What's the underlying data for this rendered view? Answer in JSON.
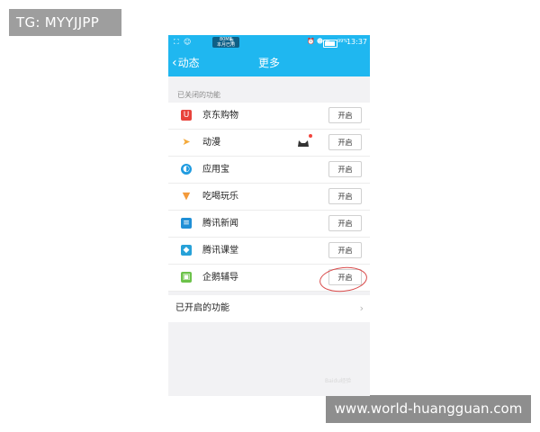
{
  "overlay": {
    "tg_tag": "TG: MYYJJPP",
    "url_tag": "www.world-huangguan.com"
  },
  "status_bar": {
    "net_speed": "80MB",
    "net_sub": "本月已用",
    "battery_pct": "99%",
    "time": "13:37"
  },
  "nav": {
    "back_label": "动态",
    "title": "更多"
  },
  "closed_section": {
    "label": "已关闭的功能",
    "items": [
      {
        "label": "京东购物",
        "button": "开启",
        "icon": "jd-shopping-icon",
        "color": "#e8433b"
      },
      {
        "label": "动漫",
        "button": "开启",
        "icon": "paper-plane-icon",
        "color": "#f4a93a"
      },
      {
        "label": "应用宝",
        "button": "开启",
        "icon": "app-store-icon",
        "color": "#1f9be0"
      },
      {
        "label": "吃喝玩乐",
        "button": "开启",
        "icon": "ice-cream-icon",
        "color": "#f39a3b"
      },
      {
        "label": "腾讯新闻",
        "button": "开启",
        "icon": "news-icon",
        "color": "#1f8fd6"
      },
      {
        "label": "腾讯课堂",
        "button": "开启",
        "icon": "classroom-icon",
        "color": "#27a1d8"
      },
      {
        "label": "企鹅辅导",
        "button": "开启",
        "icon": "penguin-tutor-icon",
        "color": "#6cc24a"
      }
    ]
  },
  "enabled_section": {
    "label": "已开启的功能"
  },
  "watermark": "Baidu经验"
}
